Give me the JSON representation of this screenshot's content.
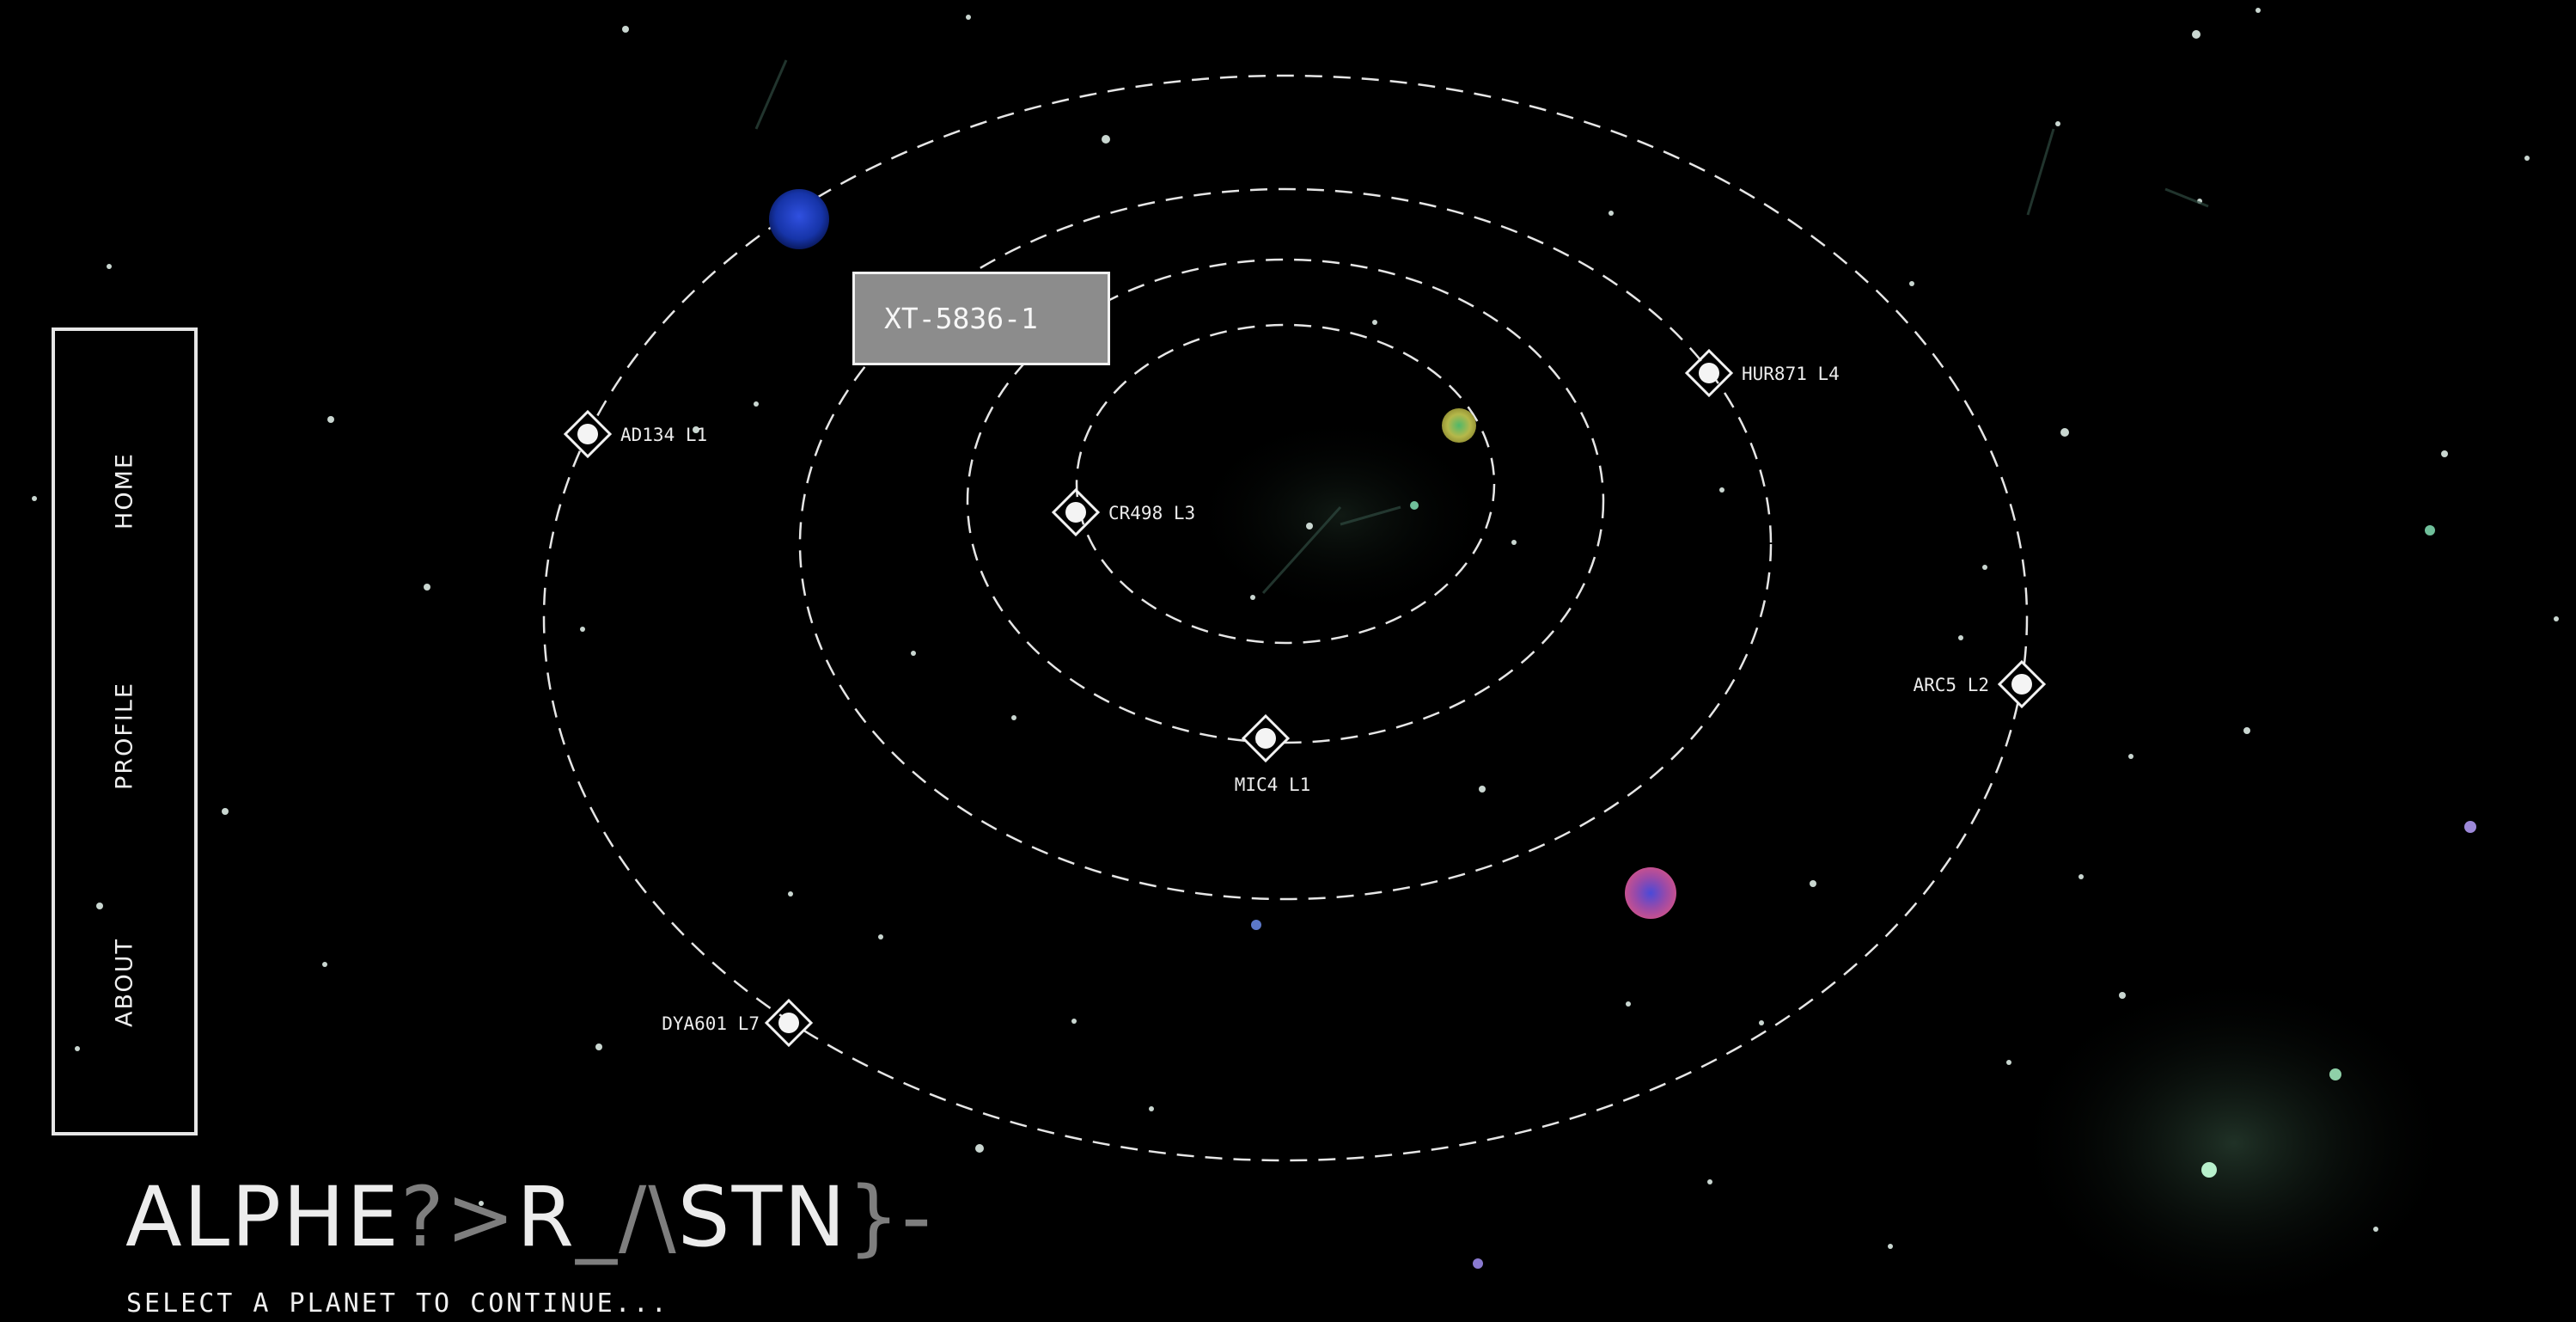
{
  "nav": {
    "items": [
      {
        "label": "HOME"
      },
      {
        "label": "PROFILE"
      },
      {
        "label": "ABOUT"
      }
    ]
  },
  "tooltip": {
    "label": "XT-5836-1"
  },
  "markers": [
    {
      "label": "AD134 L1"
    },
    {
      "label": "CR498 L3"
    },
    {
      "label": "HUR871 L4"
    },
    {
      "label": "ARC5 L2"
    },
    {
      "label": "MIC4 L1"
    },
    {
      "label": "DYA601 L7"
    }
  ],
  "planets": [
    {
      "name": "blue-planet",
      "color": "#1b43c8"
    },
    {
      "name": "yellow-planet",
      "color": "#b9b84a"
    },
    {
      "name": "pink-planet",
      "color": "#d0528a"
    }
  ],
  "brand": {
    "part1": "ALPHE",
    "part2": "?>",
    "part3": "R",
    "part4": "_/\\",
    "part5": "STN",
    "part6": "}-"
  },
  "subtitle": "SELECT A PLANET TO CONTINUE..."
}
